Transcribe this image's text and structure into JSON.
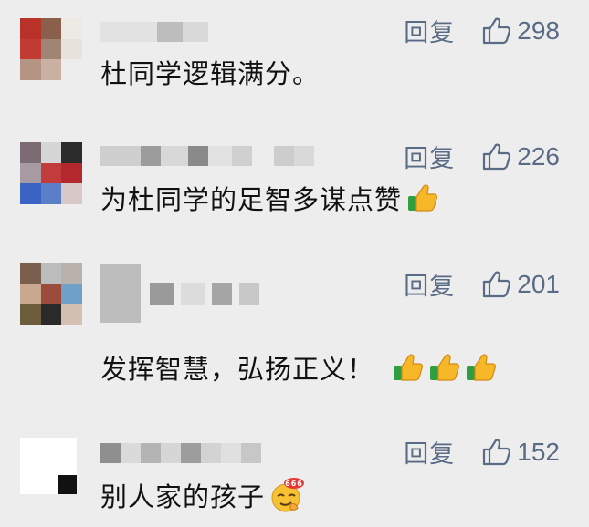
{
  "comments": [
    {
      "reply_label": "回复",
      "likes": "298",
      "text": "杜同学逻辑满分。",
      "emojis": []
    },
    {
      "reply_label": "回复",
      "likes": "226",
      "text": "为杜同学的足智多谋点赞",
      "emojis": [
        "thumbs-up-icon"
      ]
    },
    {
      "reply_label": "回复",
      "likes": "201",
      "text": "发挥智慧，弘扬正义！",
      "emojis": [
        "thumbs-up-icon",
        "thumbs-up-icon",
        "thumbs-up-icon"
      ]
    },
    {
      "reply_label": "回复",
      "likes": "152",
      "text": "别人家的孩子",
      "emojis": [
        "666-smug-face-icon"
      ]
    }
  ],
  "emoji_666_label": "666",
  "colors": {
    "background": "#ededed",
    "action_text": "#5a6b86",
    "comment_text": "#111111"
  }
}
